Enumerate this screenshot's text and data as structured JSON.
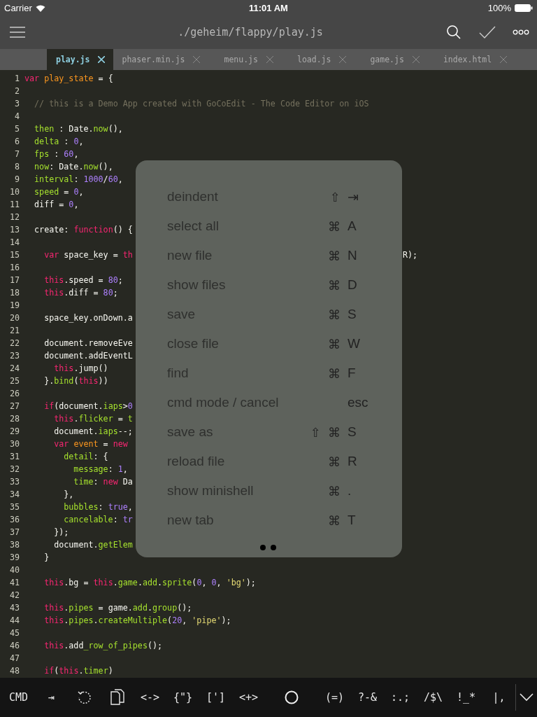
{
  "status_bar": {
    "carrier": "Carrier",
    "time": "11:01 AM",
    "battery": "100%"
  },
  "toolbar": {
    "title": "./geheim/flappy/play.js"
  },
  "tabs": [
    {
      "label": "play.js",
      "selected": true
    },
    {
      "label": "phaser.min.js",
      "selected": false
    },
    {
      "label": "menu.js",
      "selected": false
    },
    {
      "label": "load.js",
      "selected": false
    },
    {
      "label": "game.js",
      "selected": false
    },
    {
      "label": "index.html",
      "selected": false
    }
  ],
  "code_lines": [
    {
      "number": "1",
      "tokens": [
        {
          "kind": "kw",
          "text": "var "
        },
        {
          "kind": "name",
          "text": "play_state"
        },
        {
          "kind": "txt",
          "text": " = {"
        }
      ]
    },
    {
      "number": "2"
    },
    {
      "number": "3",
      "tokens": [
        {
          "kind": "com",
          "text": "  // this is a Demo App created with GoCoEdit - The Code Editor on iOS"
        }
      ]
    },
    {
      "number": "4"
    },
    {
      "number": "5",
      "tokens": [
        {
          "kind": "prop",
          "text": "  then"
        },
        {
          "kind": "txt",
          "text": " : Date."
        },
        {
          "kind": "prop",
          "text": "now"
        },
        {
          "kind": "txt",
          "text": "(),"
        }
      ]
    },
    {
      "number": "6",
      "tokens": [
        {
          "kind": "prop",
          "text": "  delta"
        },
        {
          "kind": "txt",
          "text": " : "
        },
        {
          "kind": "num",
          "text": "0"
        },
        {
          "kind": "txt",
          "text": ","
        }
      ]
    },
    {
      "number": "7",
      "tokens": [
        {
          "kind": "prop",
          "text": "  fps"
        },
        {
          "kind": "txt",
          "text": " : "
        },
        {
          "kind": "num",
          "text": "60"
        },
        {
          "kind": "txt",
          "text": ","
        }
      ]
    },
    {
      "number": "8",
      "tokens": [
        {
          "kind": "prop",
          "text": "  now"
        },
        {
          "kind": "txt",
          "text": ": Date."
        },
        {
          "kind": "prop",
          "text": "now"
        },
        {
          "kind": "txt",
          "text": "(),"
        }
      ]
    },
    {
      "number": "9",
      "tokens": [
        {
          "kind": "prop",
          "text": "  interval"
        },
        {
          "kind": "txt",
          "text": ": "
        },
        {
          "kind": "num",
          "text": "1000"
        },
        {
          "kind": "txt",
          "text": "/"
        },
        {
          "kind": "num",
          "text": "60"
        },
        {
          "kind": "txt",
          "text": ","
        }
      ]
    },
    {
      "number": "10",
      "tokens": [
        {
          "kind": "prop",
          "text": "  speed"
        },
        {
          "kind": "txt",
          "text": " = "
        },
        {
          "kind": "num",
          "text": "0"
        },
        {
          "kind": "txt",
          "text": ","
        }
      ]
    },
    {
      "number": "11",
      "tokens": [
        {
          "kind": "txt",
          "text": "  diff = "
        },
        {
          "kind": "num",
          "text": "0"
        },
        {
          "kind": "txt",
          "text": ","
        }
      ]
    },
    {
      "number": "12"
    },
    {
      "number": "13",
      "tokens": [
        {
          "kind": "txt",
          "text": "  create: "
        },
        {
          "kind": "kw",
          "text": "function"
        },
        {
          "kind": "txt",
          "text": "() {"
        }
      ]
    },
    {
      "number": "14"
    },
    {
      "number": "15",
      "tokens": [
        {
          "kind": "kw",
          "text": "    var"
        },
        {
          "kind": "txt",
          "text": " space_key = "
        },
        {
          "kind": "kw",
          "text": "th"
        }
      ],
      "tail": "R);"
    },
    {
      "number": "16"
    },
    {
      "number": "17",
      "tokens": [
        {
          "kind": "kw",
          "text": "    this"
        },
        {
          "kind": "txt",
          "text": ".speed = "
        },
        {
          "kind": "num",
          "text": "80"
        },
        {
          "kind": "txt",
          "text": ";"
        }
      ]
    },
    {
      "number": "18",
      "tokens": [
        {
          "kind": "kw",
          "text": "    this"
        },
        {
          "kind": "txt",
          "text": ".diff = "
        },
        {
          "kind": "num",
          "text": "80"
        },
        {
          "kind": "txt",
          "text": ";"
        }
      ]
    },
    {
      "number": "19"
    },
    {
      "number": "20",
      "tokens": [
        {
          "kind": "txt",
          "text": "    space_key.onDown.a"
        }
      ]
    },
    {
      "number": "21"
    },
    {
      "number": "22",
      "tokens": [
        {
          "kind": "txt",
          "text": "    document.removeEve"
        }
      ]
    },
    {
      "number": "23",
      "tokens": [
        {
          "kind": "txt",
          "text": "    document.addEventL"
        }
      ]
    },
    {
      "number": "24",
      "tokens": [
        {
          "kind": "kw",
          "text": "      this"
        },
        {
          "kind": "txt",
          "text": ".jump()"
        }
      ]
    },
    {
      "number": "25",
      "tokens": [
        {
          "kind": "txt",
          "text": "    }."
        },
        {
          "kind": "prop",
          "text": "bind"
        },
        {
          "kind": "txt",
          "text": "("
        },
        {
          "kind": "kw",
          "text": "this"
        },
        {
          "kind": "txt",
          "text": "))"
        }
      ]
    },
    {
      "number": "26"
    },
    {
      "number": "27",
      "tokens": [
        {
          "kind": "kw",
          "text": "    if"
        },
        {
          "kind": "txt",
          "text": "(document."
        },
        {
          "kind": "prop",
          "text": "iaps"
        },
        {
          "kind": "txt",
          "text": ">"
        },
        {
          "kind": "num",
          "text": "0"
        }
      ]
    },
    {
      "number": "28",
      "tokens": [
        {
          "kind": "kw",
          "text": "      this"
        },
        {
          "kind": "txt",
          "text": "."
        },
        {
          "kind": "prop",
          "text": "flicker"
        },
        {
          "kind": "txt",
          "text": " = "
        },
        {
          "kind": "prop",
          "text": "t"
        }
      ]
    },
    {
      "number": "29",
      "tokens": [
        {
          "kind": "txt",
          "text": "      document."
        },
        {
          "kind": "prop",
          "text": "iaps"
        },
        {
          "kind": "txt",
          "text": "--;"
        }
      ]
    },
    {
      "number": "30",
      "tokens": [
        {
          "kind": "kw",
          "text": "      var "
        },
        {
          "kind": "name",
          "text": "event"
        },
        {
          "kind": "txt",
          "text": " = "
        },
        {
          "kind": "kw",
          "text": "new"
        }
      ]
    },
    {
      "number": "31",
      "tokens": [
        {
          "kind": "prop",
          "text": "        detail"
        },
        {
          "kind": "txt",
          "text": ": {"
        }
      ]
    },
    {
      "number": "32",
      "tokens": [
        {
          "kind": "prop",
          "text": "          message"
        },
        {
          "kind": "txt",
          "text": ": "
        },
        {
          "kind": "num",
          "text": "1"
        },
        {
          "kind": "txt",
          "text": ","
        }
      ]
    },
    {
      "number": "33",
      "tokens": [
        {
          "kind": "prop",
          "text": "          time"
        },
        {
          "kind": "txt",
          "text": ": "
        },
        {
          "kind": "kw",
          "text": "new"
        },
        {
          "kind": "txt",
          "text": " Da"
        }
      ]
    },
    {
      "number": "34",
      "tokens": [
        {
          "kind": "txt",
          "text": "        },"
        }
      ]
    },
    {
      "number": "35",
      "tokens": [
        {
          "kind": "prop",
          "text": "        bubbles"
        },
        {
          "kind": "txt",
          "text": ": "
        },
        {
          "kind": "num",
          "text": "true"
        },
        {
          "kind": "txt",
          "text": ","
        }
      ]
    },
    {
      "number": "36",
      "tokens": [
        {
          "kind": "prop",
          "text": "        cancelable"
        },
        {
          "kind": "txt",
          "text": ": "
        },
        {
          "kind": "num",
          "text": "tr"
        }
      ]
    },
    {
      "number": "37",
      "tokens": [
        {
          "kind": "txt",
          "text": "      });"
        }
      ]
    },
    {
      "number": "38",
      "tokens": [
        {
          "kind": "txt",
          "text": "      document."
        },
        {
          "kind": "prop",
          "text": "getElem"
        }
      ]
    },
    {
      "number": "39",
      "tokens": [
        {
          "kind": "txt",
          "text": "    }"
        }
      ]
    },
    {
      "number": "40"
    },
    {
      "number": "41",
      "tokens": [
        {
          "kind": "kw",
          "text": "    this"
        },
        {
          "kind": "txt",
          "text": ".bg = "
        },
        {
          "kind": "kw",
          "text": "this"
        },
        {
          "kind": "txt",
          "text": "."
        },
        {
          "kind": "prop",
          "text": "game"
        },
        {
          "kind": "txt",
          "text": "."
        },
        {
          "kind": "prop",
          "text": "add"
        },
        {
          "kind": "txt",
          "text": "."
        },
        {
          "kind": "prop",
          "text": "sprite"
        },
        {
          "kind": "txt",
          "text": "("
        },
        {
          "kind": "num",
          "text": "0"
        },
        {
          "kind": "txt",
          "text": ", "
        },
        {
          "kind": "num",
          "text": "0"
        },
        {
          "kind": "txt",
          "text": ", "
        },
        {
          "kind": "str",
          "text": "'bg'"
        },
        {
          "kind": "txt",
          "text": ");"
        }
      ]
    },
    {
      "number": "42"
    },
    {
      "number": "43",
      "tokens": [
        {
          "kind": "kw",
          "text": "    this"
        },
        {
          "kind": "txt",
          "text": "."
        },
        {
          "kind": "prop",
          "text": "pipes"
        },
        {
          "kind": "txt",
          "text": " = game."
        },
        {
          "kind": "prop",
          "text": "add"
        },
        {
          "kind": "txt",
          "text": "."
        },
        {
          "kind": "prop",
          "text": "group"
        },
        {
          "kind": "txt",
          "text": "();"
        }
      ]
    },
    {
      "number": "44",
      "tokens": [
        {
          "kind": "kw",
          "text": "    this"
        },
        {
          "kind": "txt",
          "text": "."
        },
        {
          "kind": "prop",
          "text": "pipes"
        },
        {
          "kind": "txt",
          "text": "."
        },
        {
          "kind": "prop",
          "text": "createMultiple"
        },
        {
          "kind": "txt",
          "text": "("
        },
        {
          "kind": "num",
          "text": "20"
        },
        {
          "kind": "txt",
          "text": ", "
        },
        {
          "kind": "str",
          "text": "'pipe'"
        },
        {
          "kind": "txt",
          "text": ");"
        }
      ]
    },
    {
      "number": "45"
    },
    {
      "number": "46",
      "tokens": [
        {
          "kind": "kw",
          "text": "    this"
        },
        {
          "kind": "txt",
          "text": ".add"
        },
        {
          "kind": "prop",
          "text": "_row_of_pipes"
        },
        {
          "kind": "txt",
          "text": "();"
        }
      ]
    },
    {
      "number": "47"
    },
    {
      "number": "48",
      "tokens": [
        {
          "kind": "kw",
          "text": "    if"
        },
        {
          "kind": "txt",
          "text": "("
        },
        {
          "kind": "kw",
          "text": "this"
        },
        {
          "kind": "txt",
          "text": "."
        },
        {
          "kind": "prop",
          "text": "timer"
        },
        {
          "kind": "txt",
          "text": ")"
        }
      ]
    }
  ],
  "shortcut_menu": [
    {
      "label": "deindent",
      "modifiers": [
        "⇧"
      ],
      "key": "⇥"
    },
    {
      "label": "select all",
      "modifiers": [
        "⌘"
      ],
      "key": "A"
    },
    {
      "label": "new file",
      "modifiers": [
        "⌘"
      ],
      "key": "N"
    },
    {
      "label": "show files",
      "modifiers": [
        "⌘"
      ],
      "key": "D"
    },
    {
      "label": "save",
      "modifiers": [
        "⌘"
      ],
      "key": "S"
    },
    {
      "label": "close file",
      "modifiers": [
        "⌘"
      ],
      "key": "W"
    },
    {
      "label": "find",
      "modifiers": [
        "⌘"
      ],
      "key": "F"
    },
    {
      "label": "cmd mode / cancel",
      "key": "esc"
    },
    {
      "label": "save as",
      "modifiers": [
        "⇧",
        "⌘"
      ],
      "key": "S"
    },
    {
      "label": "reload file",
      "modifiers": [
        "⌘"
      ],
      "key": "R"
    },
    {
      "label": "show minishell",
      "modifiers": [
        "⌘"
      ],
      "key": "."
    },
    {
      "label": "new tab",
      "modifiers": [
        "⌘"
      ],
      "key": "T"
    }
  ],
  "key_bar": [
    {
      "kind": "text",
      "label": "CMD"
    },
    {
      "kind": "text",
      "label": "⇥"
    },
    {
      "kind": "undo"
    },
    {
      "kind": "copy"
    },
    {
      "kind": "text",
      "label": "<->"
    },
    {
      "kind": "text",
      "label": "{\"}"
    },
    {
      "kind": "text",
      "label": "[']"
    },
    {
      "kind": "text",
      "label": "<+>"
    },
    {
      "kind": "circle"
    },
    {
      "kind": "text",
      "label": "(=)"
    },
    {
      "kind": "text",
      "label": "?-&"
    },
    {
      "kind": "text",
      "label": ":.;"
    },
    {
      "kind": "text",
      "label": "/$\\"
    },
    {
      "kind": "text",
      "label": "!_*"
    },
    {
      "kind": "text",
      "label": "|,"
    },
    {
      "kind": "collapse"
    }
  ]
}
